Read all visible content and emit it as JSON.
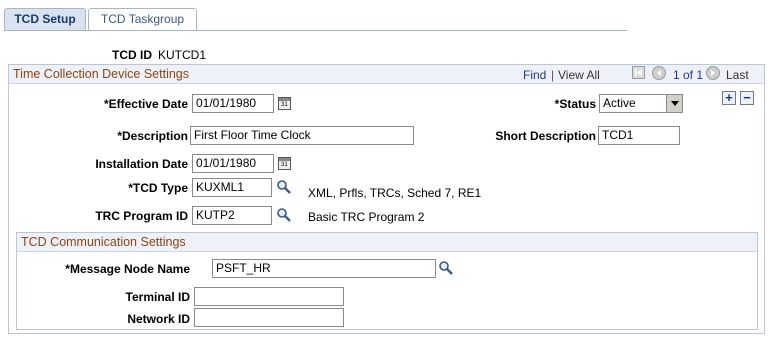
{
  "tabs": [
    {
      "label": "TCD Setup",
      "active": true
    },
    {
      "label": "TCD Taskgroup",
      "active": false
    }
  ],
  "tcd_id": {
    "label": "TCD ID",
    "value": "KUTCD1"
  },
  "settings": {
    "title": "Time Collection Device Settings",
    "nav": {
      "find": "Find",
      "separator": "|",
      "view_all": "View All",
      "page_info": "1 of 1",
      "last": "Last"
    },
    "effective_date": {
      "label": "*Effective Date",
      "value": "01/01/1980"
    },
    "status": {
      "label": "*Status",
      "value": "Active"
    },
    "description": {
      "label": "*Description",
      "value": "First Floor Time Clock"
    },
    "short_description": {
      "label": "Short Description",
      "value": "TCD1"
    },
    "installation_date": {
      "label": "Installation Date",
      "value": "01/01/1980"
    },
    "tcd_type": {
      "label": "*TCD Type",
      "value": "KUXML1",
      "desc": "XML, Prfls, TRCs, Sched 7, RE1"
    },
    "trc_program_id": {
      "label": "TRC Program ID",
      "value": "KUTP2",
      "desc": "Basic TRC Program 2"
    },
    "add_button": "+",
    "delete_button": "−"
  },
  "communication": {
    "title": "TCD Communication Settings",
    "message_node": {
      "label": "*Message Node Name",
      "value": "PSFT_HR"
    },
    "terminal_id": {
      "label": "Terminal ID",
      "value": ""
    },
    "network_id": {
      "label": "Network ID",
      "value": ""
    }
  },
  "colors": {
    "section_title": "#8b4513",
    "link": "#1b3a8a",
    "tab_active_bg": "#d9e3f0"
  }
}
